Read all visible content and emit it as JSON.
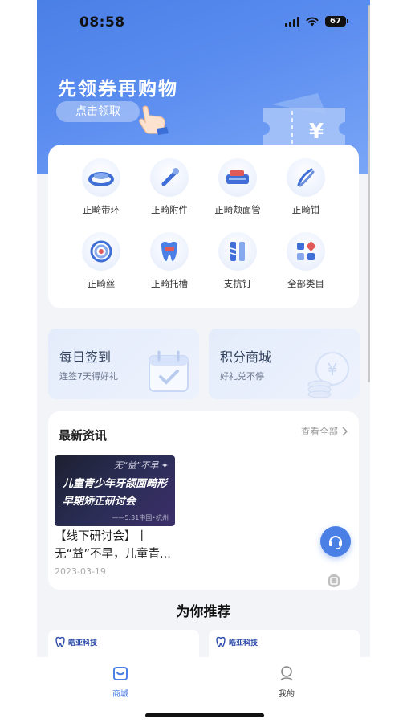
{
  "status_bar": {
    "time": "08:58",
    "battery": "67"
  },
  "hero": {
    "title": "先领券再购物",
    "button_label": "点击领取",
    "ticket_symbol": "¥"
  },
  "categories": [
    {
      "label": "正畸带环",
      "icon": "band-ring-icon"
    },
    {
      "label": "正畸附件",
      "icon": "attachment-tool-icon"
    },
    {
      "label": "正畸颊面管",
      "icon": "buccal-tube-icon"
    },
    {
      "label": "正畸钳",
      "icon": "pliers-icon"
    },
    {
      "label": "正畸丝",
      "icon": "wire-icon"
    },
    {
      "label": "正畸托槽",
      "icon": "bracket-tooth-icon"
    },
    {
      "label": "支抗钉",
      "icon": "anchor-screw-icon"
    },
    {
      "label": "全部类目",
      "icon": "all-categories-icon"
    }
  ],
  "promos": {
    "checkin": {
      "title": "每日签到",
      "subtitle": "连签7天得好礼"
    },
    "points": {
      "title": "积分商城",
      "subtitle": "好礼兑不停"
    }
  },
  "news": {
    "section_title": "最新资讯",
    "more_label": "查看全部",
    "image_text": {
      "top": "无“益”不早 ✦",
      "line1": "儿童青少年牙颌面畸形",
      "line2": "早期矫正研讨会",
      "footer": "——5.31中国•杭州"
    },
    "headline": "【线下研讨会】丨无“益”不早，儿童青...",
    "date": "2023-03-19"
  },
  "recommend": {
    "title": "为你推荐",
    "logo_name": "皓亚科技"
  },
  "tabbar": {
    "tabs": [
      {
        "label": "商城"
      },
      {
        "label": "我的"
      }
    ]
  },
  "colors": {
    "accent": "#4a7fe6",
    "page_bg": "#f2f4f8"
  }
}
